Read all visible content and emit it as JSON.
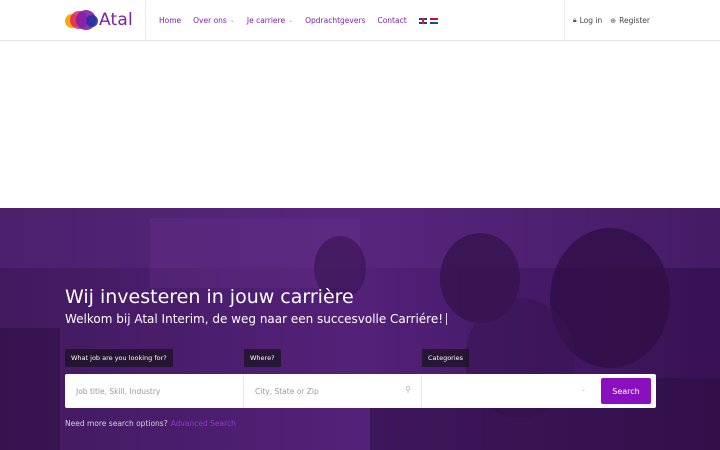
{
  "header": {
    "logo_text": "Atal",
    "nav": [
      {
        "label": "Home",
        "dropdown": false
      },
      {
        "label": "Over ons",
        "dropdown": true
      },
      {
        "label": "Je carriere",
        "dropdown": true
      },
      {
        "label": "Opdrachtgevers",
        "dropdown": false
      },
      {
        "label": "Contact",
        "dropdown": false
      }
    ],
    "languages": [
      "en",
      "nl"
    ],
    "login_label": "Log in",
    "register_label": "Register"
  },
  "hero": {
    "title": "Wij investeren in jouw carrière",
    "subtitle": "Welkom bij Atal Interim, de weg naar een succesvolle Carriére!",
    "labels": {
      "what": "What job are you looking for?",
      "where": "Where?",
      "categories": "Categories"
    },
    "search": {
      "what_placeholder": "Job title, Skill, Industry",
      "where_placeholder": "City, State or Zip",
      "category_value": "",
      "button_label": "Search"
    },
    "more_text": "Need more search options?",
    "more_link": "Advanced Search"
  },
  "colors": {
    "brand": "#7d1fa8",
    "button": "#8a0fbf",
    "hero_overlay": "#4a2264"
  }
}
